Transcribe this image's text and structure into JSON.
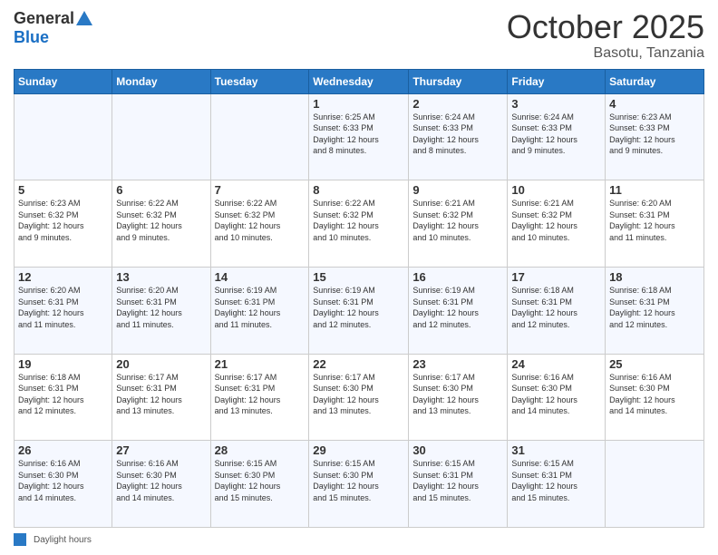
{
  "header": {
    "logo_general": "General",
    "logo_blue": "Blue",
    "month": "October 2025",
    "location": "Basotu, Tanzania"
  },
  "weekdays": [
    "Sunday",
    "Monday",
    "Tuesday",
    "Wednesday",
    "Thursday",
    "Friday",
    "Saturday"
  ],
  "footer_label": "Daylight hours",
  "weeks": [
    [
      {
        "day": "",
        "info": ""
      },
      {
        "day": "",
        "info": ""
      },
      {
        "day": "",
        "info": ""
      },
      {
        "day": "1",
        "info": "Sunrise: 6:25 AM\nSunset: 6:33 PM\nDaylight: 12 hours\nand 8 minutes."
      },
      {
        "day": "2",
        "info": "Sunrise: 6:24 AM\nSunset: 6:33 PM\nDaylight: 12 hours\nand 8 minutes."
      },
      {
        "day": "3",
        "info": "Sunrise: 6:24 AM\nSunset: 6:33 PM\nDaylight: 12 hours\nand 9 minutes."
      },
      {
        "day": "4",
        "info": "Sunrise: 6:23 AM\nSunset: 6:33 PM\nDaylight: 12 hours\nand 9 minutes."
      }
    ],
    [
      {
        "day": "5",
        "info": "Sunrise: 6:23 AM\nSunset: 6:32 PM\nDaylight: 12 hours\nand 9 minutes."
      },
      {
        "day": "6",
        "info": "Sunrise: 6:22 AM\nSunset: 6:32 PM\nDaylight: 12 hours\nand 9 minutes."
      },
      {
        "day": "7",
        "info": "Sunrise: 6:22 AM\nSunset: 6:32 PM\nDaylight: 12 hours\nand 10 minutes."
      },
      {
        "day": "8",
        "info": "Sunrise: 6:22 AM\nSunset: 6:32 PM\nDaylight: 12 hours\nand 10 minutes."
      },
      {
        "day": "9",
        "info": "Sunrise: 6:21 AM\nSunset: 6:32 PM\nDaylight: 12 hours\nand 10 minutes."
      },
      {
        "day": "10",
        "info": "Sunrise: 6:21 AM\nSunset: 6:32 PM\nDaylight: 12 hours\nand 10 minutes."
      },
      {
        "day": "11",
        "info": "Sunrise: 6:20 AM\nSunset: 6:31 PM\nDaylight: 12 hours\nand 11 minutes."
      }
    ],
    [
      {
        "day": "12",
        "info": "Sunrise: 6:20 AM\nSunset: 6:31 PM\nDaylight: 12 hours\nand 11 minutes."
      },
      {
        "day": "13",
        "info": "Sunrise: 6:20 AM\nSunset: 6:31 PM\nDaylight: 12 hours\nand 11 minutes."
      },
      {
        "day": "14",
        "info": "Sunrise: 6:19 AM\nSunset: 6:31 PM\nDaylight: 12 hours\nand 11 minutes."
      },
      {
        "day": "15",
        "info": "Sunrise: 6:19 AM\nSunset: 6:31 PM\nDaylight: 12 hours\nand 12 minutes."
      },
      {
        "day": "16",
        "info": "Sunrise: 6:19 AM\nSunset: 6:31 PM\nDaylight: 12 hours\nand 12 minutes."
      },
      {
        "day": "17",
        "info": "Sunrise: 6:18 AM\nSunset: 6:31 PM\nDaylight: 12 hours\nand 12 minutes."
      },
      {
        "day": "18",
        "info": "Sunrise: 6:18 AM\nSunset: 6:31 PM\nDaylight: 12 hours\nand 12 minutes."
      }
    ],
    [
      {
        "day": "19",
        "info": "Sunrise: 6:18 AM\nSunset: 6:31 PM\nDaylight: 12 hours\nand 12 minutes."
      },
      {
        "day": "20",
        "info": "Sunrise: 6:17 AM\nSunset: 6:31 PM\nDaylight: 12 hours\nand 13 minutes."
      },
      {
        "day": "21",
        "info": "Sunrise: 6:17 AM\nSunset: 6:31 PM\nDaylight: 12 hours\nand 13 minutes."
      },
      {
        "day": "22",
        "info": "Sunrise: 6:17 AM\nSunset: 6:30 PM\nDaylight: 12 hours\nand 13 minutes."
      },
      {
        "day": "23",
        "info": "Sunrise: 6:17 AM\nSunset: 6:30 PM\nDaylight: 12 hours\nand 13 minutes."
      },
      {
        "day": "24",
        "info": "Sunrise: 6:16 AM\nSunset: 6:30 PM\nDaylight: 12 hours\nand 14 minutes."
      },
      {
        "day": "25",
        "info": "Sunrise: 6:16 AM\nSunset: 6:30 PM\nDaylight: 12 hours\nand 14 minutes."
      }
    ],
    [
      {
        "day": "26",
        "info": "Sunrise: 6:16 AM\nSunset: 6:30 PM\nDaylight: 12 hours\nand 14 minutes."
      },
      {
        "day": "27",
        "info": "Sunrise: 6:16 AM\nSunset: 6:30 PM\nDaylight: 12 hours\nand 14 minutes."
      },
      {
        "day": "28",
        "info": "Sunrise: 6:15 AM\nSunset: 6:30 PM\nDaylight: 12 hours\nand 15 minutes."
      },
      {
        "day": "29",
        "info": "Sunrise: 6:15 AM\nSunset: 6:30 PM\nDaylight: 12 hours\nand 15 minutes."
      },
      {
        "day": "30",
        "info": "Sunrise: 6:15 AM\nSunset: 6:31 PM\nDaylight: 12 hours\nand 15 minutes."
      },
      {
        "day": "31",
        "info": "Sunrise: 6:15 AM\nSunset: 6:31 PM\nDaylight: 12 hours\nand 15 minutes."
      },
      {
        "day": "",
        "info": ""
      }
    ]
  ]
}
